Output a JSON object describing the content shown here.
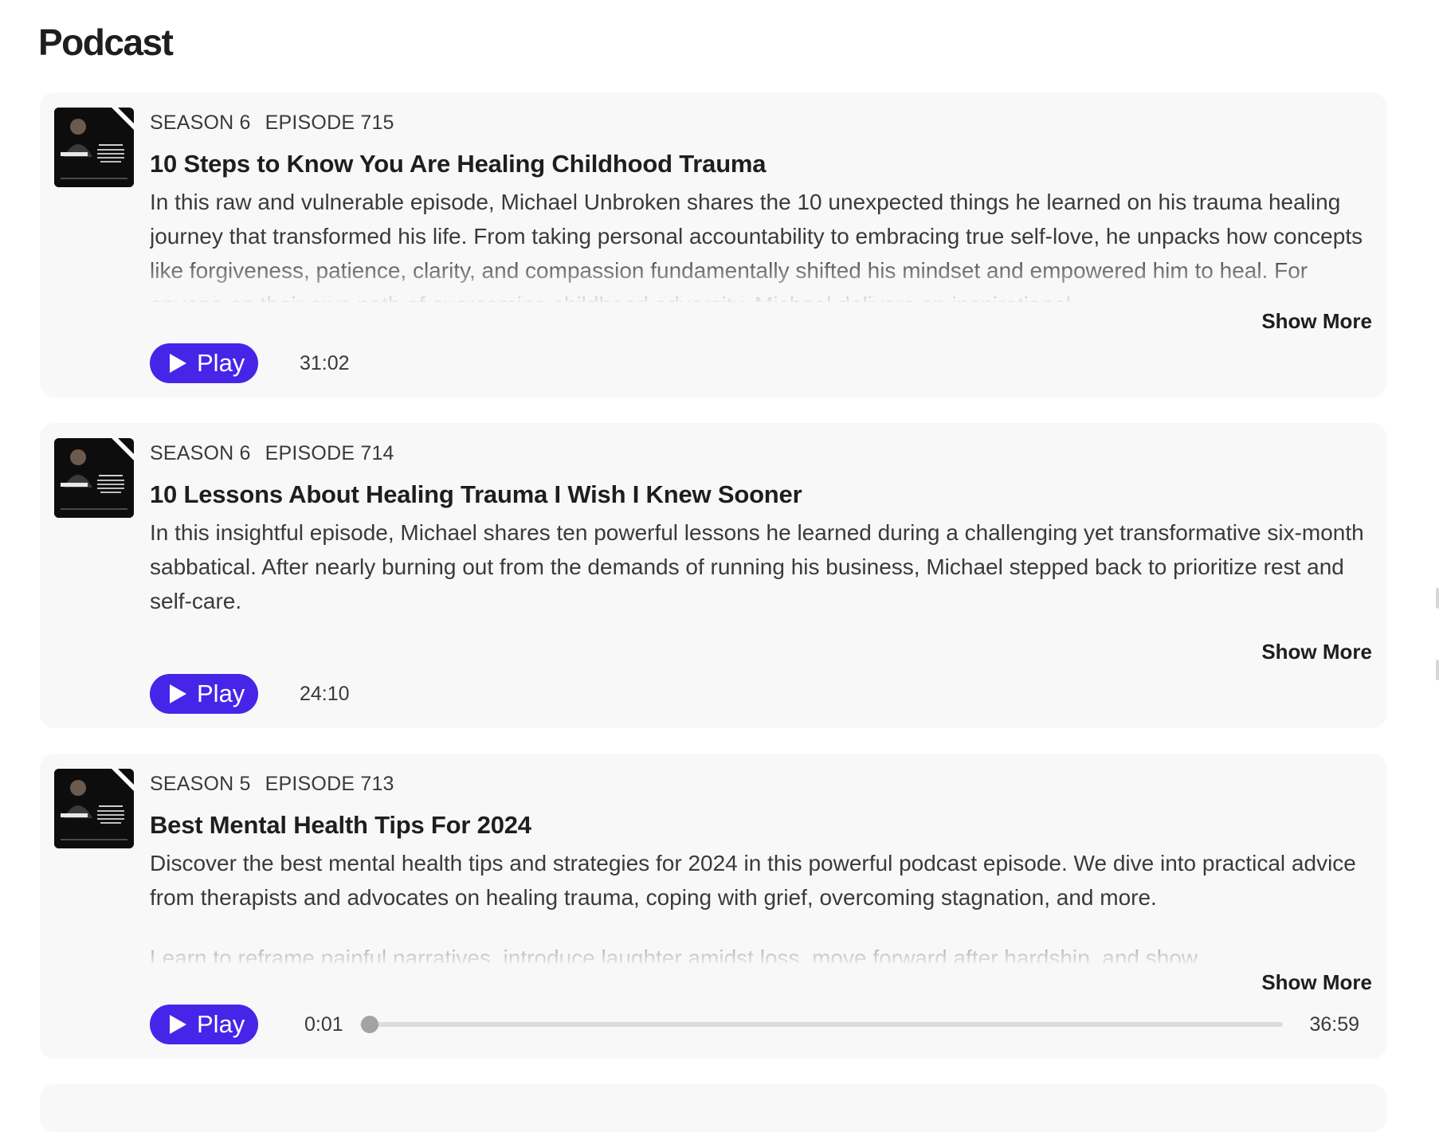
{
  "page": {
    "title": "Podcast"
  },
  "colors": {
    "accent": "#4625e9",
    "card_background": "#f8f8f8",
    "text_primary": "#1e1e1e",
    "text_secondary": "#3a3a3a",
    "progress_track": "#dcdcdc",
    "progress_knob": "#a3a3a3"
  },
  "episodes": [
    {
      "season": "SEASON 6",
      "episode": "EPISODE 715",
      "title": "10 Steps to Know You Are Healing Childhood Trauma",
      "description": [
        "In this raw and vulnerable episode, Michael Unbroken shares the 10 unexpected things he learned on his trauma healing journey that transformed his life. From taking personal accountability to embracing true self-love, he unpacks how concepts like forgiveness, patience, clarity, and compassion fundamentally shifted his mindset and empowered him to heal. For anyone on their own path of overcoming childhood adversity, Michael delivers an inspirational"
      ],
      "show_more": "Show More",
      "play_label": "Play",
      "duration": "31:02",
      "thumbnail_icon": "podcast-cover-art"
    },
    {
      "season": "SEASON 6",
      "episode": "EPISODE 714",
      "title": "10 Lessons About Healing Trauma I Wish I Knew Sooner",
      "description": [
        "In this insightful episode, Michael shares ten powerful lessons he learned during a challenging yet transformative six-month sabbatical. After nearly burning out from the demands of running his business, Michael stepped back to prioritize rest and self-care."
      ],
      "show_more": "Show More",
      "play_label": "Play",
      "duration": "24:10",
      "thumbnail_icon": "podcast-cover-art"
    },
    {
      "season": "SEASON 5",
      "episode": "EPISODE 713",
      "title": "Best Mental Health Tips For 2024",
      "description": [
        "Discover the best mental health tips and strategies for 2024 in this powerful podcast episode. We dive into practical advice from therapists and advocates on healing trauma, coping with grief, overcoming stagnation, and more.",
        "Learn to reframe painful narratives, introduce laughter amidst loss, move forward after hardship, and show"
      ],
      "show_more": "Show More",
      "play_label": "Play",
      "player": {
        "current_time": "0:01",
        "total_time": "36:59",
        "progress_fraction": 0.0005
      },
      "thumbnail_icon": "podcast-cover-art"
    }
  ]
}
